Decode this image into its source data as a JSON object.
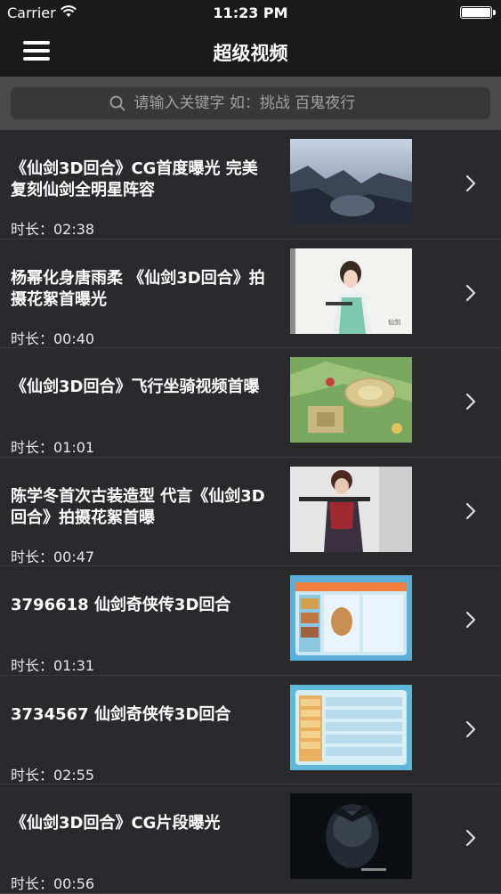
{
  "status_bar": {
    "carrier": "Carrier",
    "time": "11:23 PM"
  },
  "nav": {
    "title": "超级视频"
  },
  "search": {
    "placeholder": "请输入关键字 如：挑战 百鬼夜行"
  },
  "videos": [
    {
      "title": "《仙剑3D回合》CG首度曝光  完美复刻仙剑全明星阵容",
      "duration": "时长：02:38",
      "thumb": "cg-cliff-scene"
    },
    {
      "title": "杨幂化身唐雨柔 《仙剑3D回合》拍摄花絮首曝光",
      "duration": "时长：00:40",
      "thumb": "actress-costume"
    },
    {
      "title": "《仙剑3D回合》飞行坐骑视频首曝",
      "duration": "时长：01:01",
      "thumb": "game-map"
    },
    {
      "title": "陈学冬首次古装造型  代言《仙剑3D回合》拍摄花絮首曝",
      "duration": "时长：00:47",
      "thumb": "actor-costume"
    },
    {
      "title": "3796618 仙剑奇侠传3D回合",
      "duration": "时长：01:31",
      "thumb": "game-ui-blue"
    },
    {
      "title": "3734567 仙剑奇侠传3D回合",
      "duration": "时长：02:55",
      "thumb": "game-ui-list"
    },
    {
      "title": "《仙剑3D回合》CG片段曝光",
      "duration": "时长：00:56",
      "thumb": "cg-dark"
    }
  ],
  "colors": {
    "background": "#2a2a2c",
    "nav": "#1a1a1a",
    "search_band": "#4a4a4a"
  }
}
